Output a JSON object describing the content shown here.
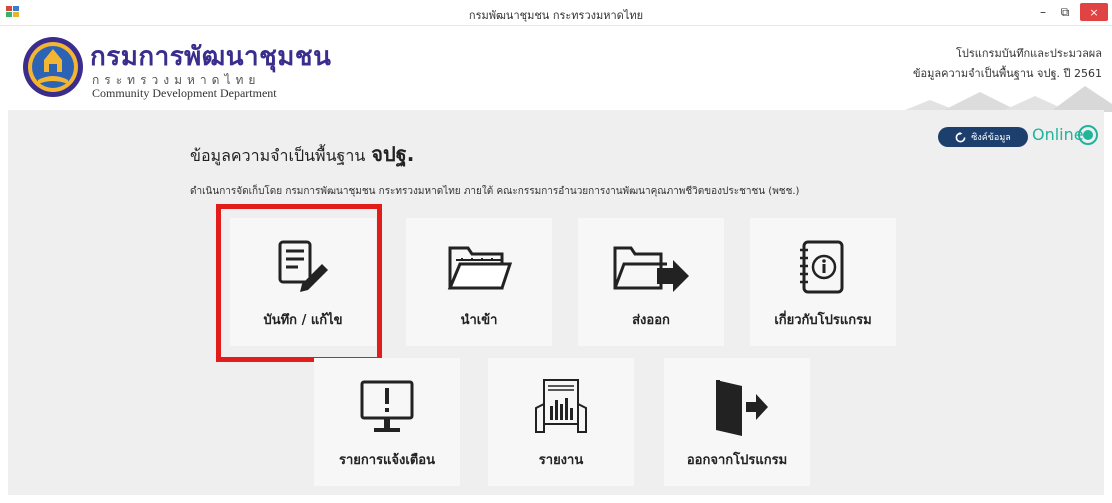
{
  "window": {
    "title": "กรมพัฒนาชุมชน กระทรวงมหาดไทย",
    "minimize": "–",
    "maximize": "⧉",
    "close": "×"
  },
  "header": {
    "logo_title": "กรมการพัฒนาชุมชน",
    "logo_ministry": "กระทรวงมหาดไทย",
    "logo_english": "Community Development Department",
    "program_line1": "โปรแกรมบันทึกและประมวลผล",
    "program_line2": "ข้อมูลความจำเป็นพื้นฐาน จปฐ. ปี 2561"
  },
  "status": {
    "sync_label": "ซิงค์ข้อมูล",
    "online_label": "Online"
  },
  "main": {
    "heading": "ข้อมูลความจำเป็นพื้นฐาน",
    "heading_bold": "จปฐ.",
    "subline": "ดำเนินการจัดเก็บโดย กรมการพัฒนาชุมชน กระทรวงมหาดไทย ภายใต้ คณะกรรมการอำนวยการงานพัฒนาคุณภาพชีวิตของประชาชน (พชช.)"
  },
  "menu": {
    "record": "บันทึก / แก้ไข",
    "import": "นำเข้า",
    "export": "ส่งออก",
    "about": "เกี่ยวกับโปรแกรม",
    "alerts": "รายการแจ้งเตือน",
    "report": "รายงาน",
    "exit": "ออกจากโปรแกรม"
  },
  "colors": {
    "accent_navy": "#1d3f6e",
    "online_green": "#20b49b",
    "highlight_red": "#e21b1b",
    "logo_purple": "#3a2d8e"
  }
}
